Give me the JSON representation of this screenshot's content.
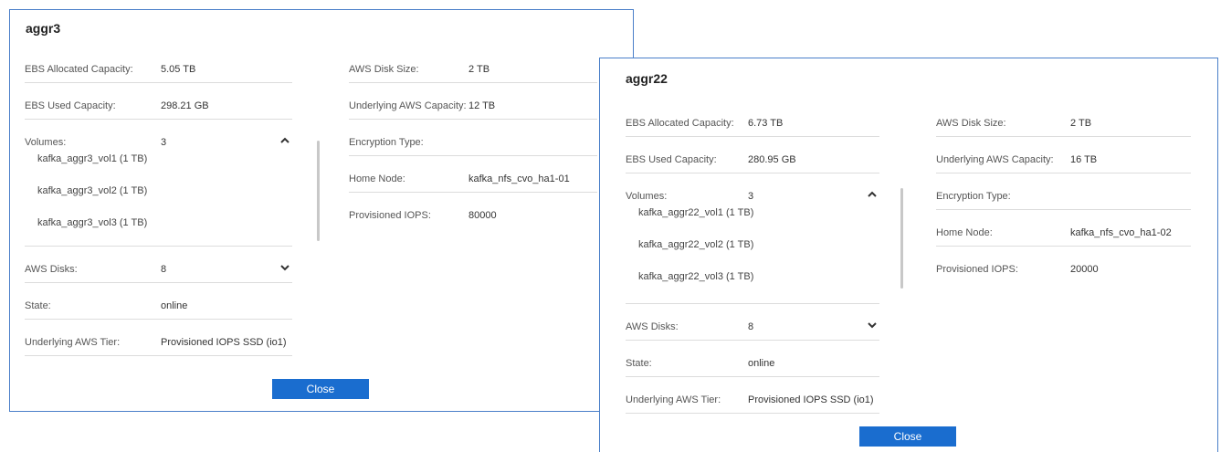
{
  "dialog1": {
    "title": "aggr3",
    "left": [
      {
        "label": "EBS Allocated Capacity:",
        "value": "5.05 TB"
      },
      {
        "label": "EBS Used Capacity:",
        "value": "298.21 GB"
      }
    ],
    "volumes": {
      "label": "Volumes:",
      "value": "3",
      "items": [
        "kafka_aggr3_vol1 (1 TB)",
        "kafka_aggr3_vol2 (1 TB)",
        "kafka_aggr3_vol3 (1 TB)"
      ]
    },
    "left_after": [
      {
        "label": "AWS Disks:",
        "value": "8"
      },
      {
        "label": "State:",
        "value": "online"
      },
      {
        "label": "Underlying AWS Tier:",
        "value": "Provisioned IOPS SSD (io1)"
      }
    ],
    "right": [
      {
        "label": "AWS Disk Size:",
        "value": "2 TB"
      },
      {
        "label": "Underlying AWS Capacity:",
        "value": "12 TB"
      },
      {
        "label": "Encryption Type:",
        "value": ""
      },
      {
        "label": "Home Node:",
        "value": "kafka_nfs_cvo_ha1-01"
      },
      {
        "label": "Provisioned IOPS:",
        "value": "80000"
      }
    ],
    "close_label": "Close"
  },
  "dialog2": {
    "title": "aggr22",
    "left": [
      {
        "label": "EBS Allocated Capacity:",
        "value": "6.73 TB"
      },
      {
        "label": "EBS Used Capacity:",
        "value": "280.95 GB"
      }
    ],
    "volumes": {
      "label": "Volumes:",
      "value": "3",
      "items": [
        "kafka_aggr22_vol1 (1 TB)",
        "kafka_aggr22_vol2 (1 TB)",
        "kafka_aggr22_vol3 (1 TB)"
      ]
    },
    "left_after": [
      {
        "label": "AWS Disks:",
        "value": "8"
      },
      {
        "label": "State:",
        "value": "online"
      },
      {
        "label": "Underlying AWS Tier:",
        "value": "Provisioned IOPS SSD (io1)"
      }
    ],
    "right": [
      {
        "label": "AWS Disk Size:",
        "value": "2 TB"
      },
      {
        "label": "Underlying AWS Capacity:",
        "value": "16 TB"
      },
      {
        "label": "Encryption Type:",
        "value": ""
      },
      {
        "label": "Home Node:",
        "value": "kafka_nfs_cvo_ha1-02"
      },
      {
        "label": "Provisioned IOPS:",
        "value": "20000"
      }
    ],
    "close_label": "Close"
  },
  "colors": {
    "border": "#4a7fc9",
    "button": "#1a6dcf",
    "divider": "#dcdcdc"
  },
  "icons": {
    "volumes_toggle": "chevron-up-icon",
    "disks_toggle": "chevron-down-icon"
  }
}
